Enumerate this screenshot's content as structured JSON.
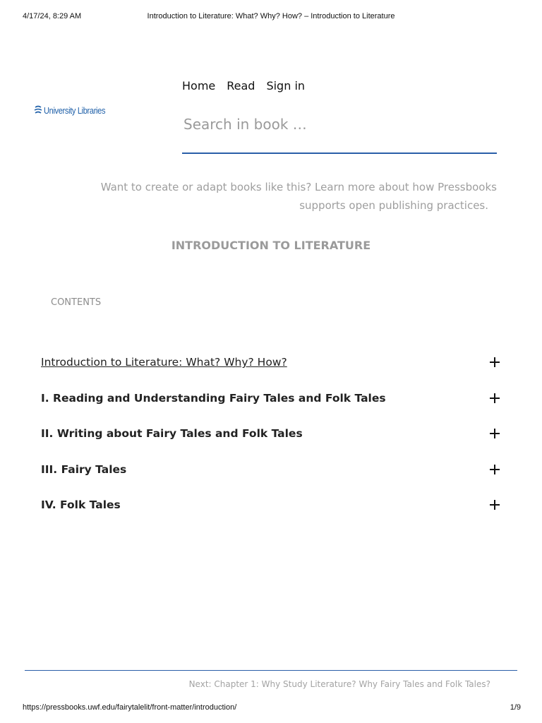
{
  "print_header": {
    "datetime": "4/17/24, 8:29 AM",
    "page_title": "Introduction to Literature: What? Why? How? – Introduction to Literature"
  },
  "logo": {
    "text": "University Libraries",
    "icon": "university-libraries-logo-icon"
  },
  "nav": {
    "items": [
      "Home",
      "Read",
      "Sign in"
    ]
  },
  "search": {
    "placeholder": "Search in book …",
    "value": ""
  },
  "promo": {
    "line1": "Want to create or adapt books like this? Learn more about how Pressbooks",
    "line2": "supports open publishing practices."
  },
  "book_title": "INTRODUCTION TO LITERATURE",
  "contents_label": "CONTENTS",
  "toc": [
    {
      "label": "Introduction to Literature: What? Why? How?",
      "icon": "plus-icon"
    },
    {
      "label": "I. Reading and Understanding Fairy Tales and Folk Tales",
      "icon": "plus-icon"
    },
    {
      "label": "II. Writing about Fairy Tales and Folk Tales",
      "icon": "plus-icon"
    },
    {
      "label": "III. Fairy Tales",
      "icon": "plus-icon"
    },
    {
      "label": "IV. Folk Tales",
      "icon": "plus-icon"
    }
  ],
  "next_link": "Next: Chapter 1: Why Study Literature? Why Fairy Tales and Folk Tales?",
  "print_footer": {
    "url": "https://pressbooks.uwf.edu/fairytalelit/front-matter/introduction/",
    "page": "1/9"
  },
  "colors": {
    "accent": "#2a5ea8",
    "logo_blue": "#1e5fa8",
    "muted_text": "#9e9e9e"
  }
}
